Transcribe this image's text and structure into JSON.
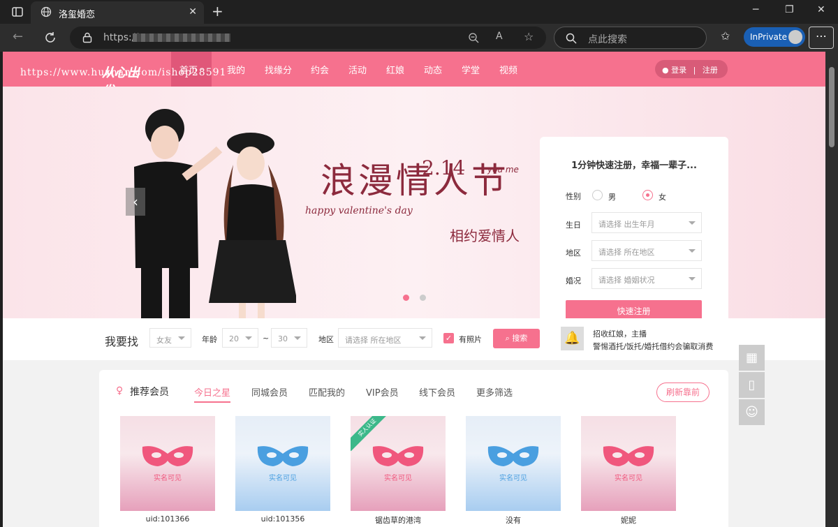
{
  "browser": {
    "tab_title": "洛玺婚恋",
    "url": "https://ww",
    "search_placeholder": "点此搜索",
    "inprivate_label": "InPrivate"
  },
  "site": {
    "logo_text": "从心出发",
    "watermark": "https://www.huzhan.com/ishop28591",
    "nav": [
      "首页",
      "我的",
      "找缘分",
      "约会",
      "活动",
      "红娘",
      "动态",
      "学堂",
      "视频"
    ],
    "login": "登录",
    "register": "注册"
  },
  "banner": {
    "title": "浪漫情人节",
    "date": "2.14",
    "subtitle": "相约爱情人",
    "happy": "happy valentine's day",
    "youme": "you me"
  },
  "reg_form": {
    "title": "1分钟快速注册，幸福一辈子...",
    "gender_label": "性别",
    "male": "男",
    "female": "女",
    "birthday_label": "生日",
    "birthday_ph": "请选择  出生年月",
    "area_label": "地区",
    "area_ph": "请选择  所在地区",
    "marital_label": "婚况",
    "marital_ph": "请选择  婚姻状况",
    "submit": "快速注册"
  },
  "search": {
    "title": "我要找",
    "target": "女友",
    "age_label": "年龄",
    "age_min": "20",
    "age_sep": "~",
    "age_max": "30",
    "area_label": "地区",
    "area_ph": "请选择  所在地区",
    "photo_label": "有照片",
    "button": "搜索",
    "notice1": "招收红娘，主播",
    "notice2": "警惕酒托/饭托/婚托借约会骗取消费"
  },
  "members": {
    "title": "推荐会员",
    "tabs": [
      "今日之星",
      "同城会员",
      "匹配我的",
      "VIP会员",
      "线下会员",
      "更多筛选"
    ],
    "refresh": "刷新靠前",
    "mask_label": "实名可见",
    "badge": "实人认证",
    "cards": [
      {
        "name": "uid:101366",
        "theme": "pink"
      },
      {
        "name": "uid:101356",
        "theme": "blue"
      },
      {
        "name": "锯齿草的港湾",
        "theme": "pink"
      },
      {
        "name": "没有",
        "theme": "blue"
      },
      {
        "name": "妮妮",
        "theme": "pink"
      }
    ]
  },
  "colors": {
    "accent": "#f6718e",
    "mask_pink": "#f0577d",
    "mask_blue": "#4a9fe0"
  }
}
